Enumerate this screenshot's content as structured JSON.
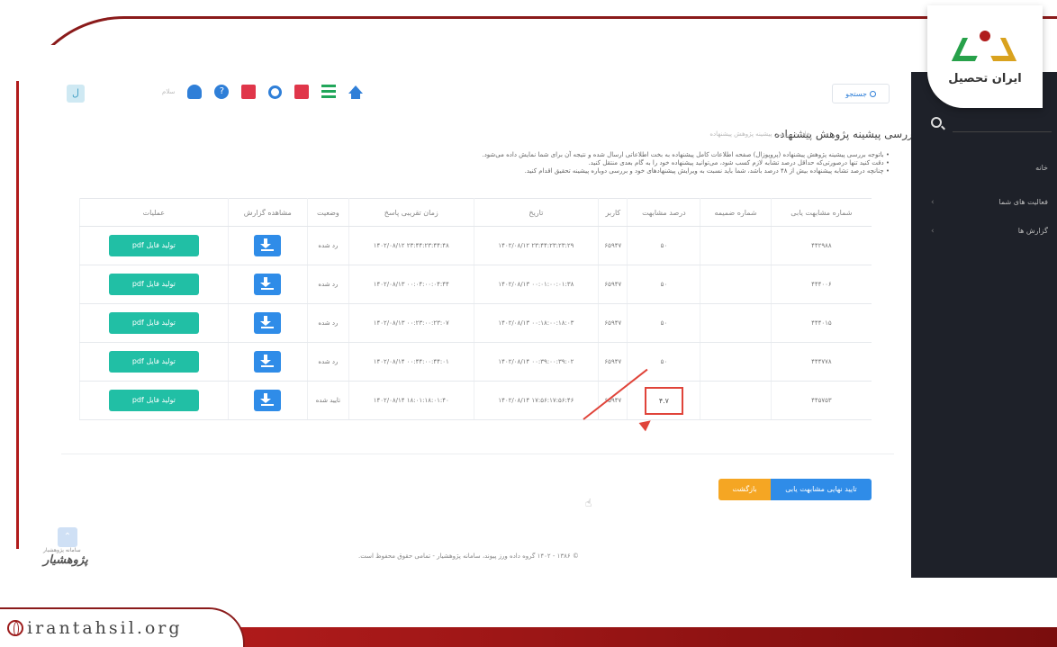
{
  "brand": {
    "logo_text": "ایران تحصیل",
    "domain": "irantahsil.org"
  },
  "topbar": {
    "user_initial": "ل",
    "mini_text": "سلام",
    "icons": [
      "bell-icon",
      "help-icon",
      "mail-icon",
      "support-icon",
      "note-icon",
      "list-icon",
      "home-icon"
    ],
    "search_label": "جستجو"
  },
  "sidebar": {
    "items": [
      "خانه",
      "فعالیت های شما",
      "گزارش ها"
    ]
  },
  "page": {
    "title": "بررسی پیشینه پژوهش پیشنهاده",
    "breadcrumb": "خانه ‹ بررسی پیشینه پژوهش پیشنهاده",
    "notes": [
      "باتوجه بررسی پیشینه پژوهش پیشنهاده (پروپوزال) صفحه اطلاعات کامل پیشنهاده به بخت اطلاعاتی ارسال شده و نتیجه آن برای شما نمایش داده می‌شود.",
      "دقت کنید تنها درصورتی‌که حداقل درصد تشابه لازم کسب شود، می‌توانید پیشنهاده خود را به گام بعدی منتقل کنید.",
      "چنانچه درصد تشابه پیشنهاده بیش از ۴۸ درصد باشد، شما باید نسبت به ویرایش پیشنهادهای خود و بررسی دوباره پیشینه تحقیق اقدام کنید."
    ]
  },
  "table": {
    "headers": [
      "شماره مشابهت یابی",
      "شماره ضمیمه",
      "درصد مشابهت",
      "کاربر",
      "تاریخ",
      "زمان تقریبی پاسخ",
      "وضعیت",
      "مشاهده گزارش",
      "عملیات"
    ],
    "rows": [
      {
        "id": "۴۴۲۹۸۸",
        "attach": "",
        "percent": "۵۰",
        "user": "۶۵۹۴۷",
        "date": "۲۳:۴۴:۲۳:۲۳:۲۹ ۱۴۰۲/۰۸/۱۲",
        "eta": "۲۳:۴۴:۲۳:۴۴:۴۸ ۱۴۰۲/۰۸/۱۲",
        "status": "رد شده",
        "highlight": false
      },
      {
        "id": "۴۴۴۰۰۶",
        "attach": "",
        "percent": "۵۰",
        "user": "۶۵۹۴۷",
        "date": "۰۰:۰۱:۰۰:۰۱:۳۸ ۱۴۰۲/۰۸/۱۳",
        "eta": "۰۰:۰۴:۰۰:۰۴:۴۴ ۱۴۰۲/۰۸/۱۳",
        "status": "رد شده",
        "highlight": false
      },
      {
        "id": "۴۴۴۰۱۵",
        "attach": "",
        "percent": "۵۰",
        "user": "۶۵۹۴۷",
        "date": "۰۰:۱۸:۰۰:۱۸:۰۳ ۱۴۰۲/۰۸/۱۳",
        "eta": "۰۰:۲۳:۰۰:۲۳:۰۷ ۱۴۰۲/۰۸/۱۳",
        "status": "رد شده",
        "highlight": false
      },
      {
        "id": "۴۴۴۷۷۸",
        "attach": "",
        "percent": "۵۰",
        "user": "۶۵۹۴۷",
        "date": "۰۰:۳۹:۰۰:۳۹:۰۲ ۱۴۰۲/۰۸/۱۴",
        "eta": "۰۰:۴۴:۰۰:۴۴:۰۱ ۱۴۰۲/۰۸/۱۴",
        "status": "رد شده",
        "highlight": false
      },
      {
        "id": "۴۴۵۷۵۳",
        "attach": "",
        "percent": "۴.۷",
        "user": "۶۵۹۴۷",
        "date": "۱۷:۵۶:۱۷:۵۶:۴۶ ۱۴۰۲/۰۸/۱۴",
        "eta": "۱۸:۰۱:۱۸:۰۱:۴۰ ۱۴۰۲/۰۸/۱۴",
        "status": "تایید شده",
        "highlight": true
      }
    ],
    "pdf_label": "تولید فایل pdf"
  },
  "actions": {
    "final_label": "تایید نهایی مشابهت یابی",
    "back_label": "بازگشت"
  },
  "footer": {
    "text": "© ۱۳۸۶ - ۱۴۰۲ گروه داده ورز پیوند، سامانه پژوهشیار - تمامی حقوق محفوظ است.",
    "brand_logo": "پژوهشیار",
    "brand_sub": "سامانه پژوهشیار"
  },
  "colors": {
    "accent_red": "#b01b1b",
    "primary_blue": "#2f8ce8",
    "teal": "#21bfa5",
    "orange": "#f5a623",
    "sidebar": "#1e2129"
  }
}
